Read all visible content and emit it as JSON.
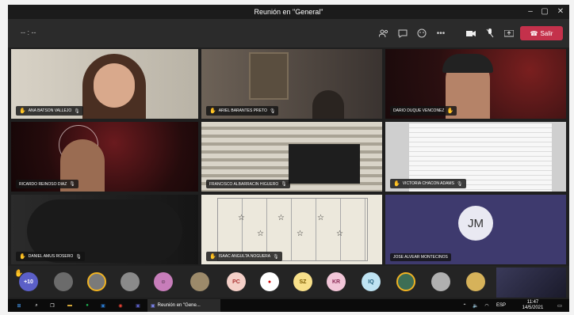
{
  "window": {
    "title": "Reunión en \"General\""
  },
  "meeting": {
    "timer": "-- : --",
    "leave_label": "Salir",
    "colors": {
      "leave": "#c4314b",
      "hand": "#f0b323"
    }
  },
  "participants": [
    {
      "name": "ANA BATSON VALLEJO",
      "hand": true
    },
    {
      "name": "ARIEL BARANTES PRETO",
      "hand": true
    },
    {
      "name": "DARIO DUQUE VENCONEZ",
      "hand": true
    },
    {
      "name": "RICARDO REINOSO DIAZ",
      "hand": false
    },
    {
      "name": "FRANCISCO ALBARRACIN HIGUERO",
      "hand": false
    },
    {
      "name": "VICTORIA CHACON ADAMS",
      "hand": true
    },
    {
      "name": "DANIEL AMUS ROSERO",
      "hand": true
    },
    {
      "name": "ISAAC ANGULTA NOGUERA",
      "hand": true
    },
    {
      "name": "JOSE ALVEAR MONTECINOS",
      "hand": false,
      "initials": "JM"
    }
  ],
  "tray": {
    "overflow_count": "+10",
    "avatars": [
      {
        "type": "photo",
        "color": "#6b6b6b"
      },
      {
        "type": "photo",
        "color": "#7a7a7a",
        "ring": true
      },
      {
        "type": "photo",
        "color": "#8a8a8a"
      },
      {
        "type": "emoji",
        "color": "#c77dba"
      },
      {
        "type": "photo",
        "color": "#9c8a6a"
      },
      {
        "type": "initials",
        "text": "PC",
        "color": "#f4d0c8"
      },
      {
        "type": "flag",
        "color": "#ffffff"
      },
      {
        "type": "initials",
        "text": "SZ",
        "color": "#f8e08a"
      },
      {
        "type": "initials",
        "text": "KR",
        "color": "#f2c6d8"
      },
      {
        "type": "initials",
        "text": "IQ",
        "color": "#bfe3f2"
      },
      {
        "type": "photo",
        "color": "#3d6e55",
        "ring": true
      },
      {
        "type": "photo",
        "color": "#b0b0b0"
      },
      {
        "type": "photo",
        "color": "#d6b25a"
      }
    ]
  },
  "taskbar": {
    "app_label": "Reunión en \"Gene...",
    "time": "11:47",
    "date": "14/5/2021",
    "lang": "ESP"
  }
}
